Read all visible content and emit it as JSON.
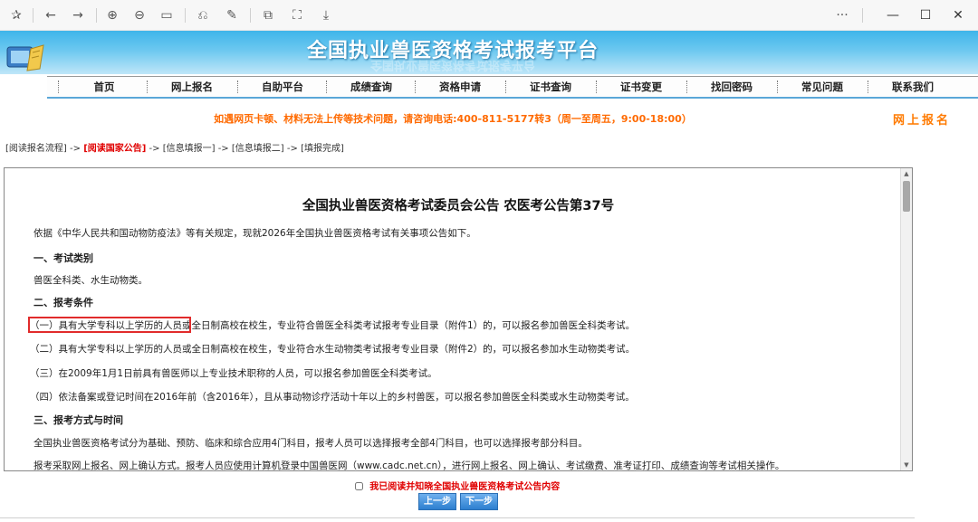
{
  "banner": {
    "title": "全国执业兽医资格考试报考平台"
  },
  "nav": [
    "首页",
    "网上报名",
    "自助平台",
    "成绩查询",
    "资格申请",
    "证书查询",
    "证书变更",
    "找回密码",
    "常见问题",
    "联系我们"
  ],
  "notice": "如遇网页卡顿、材料无法上传等技术问题，请咨询电话:400-811-5177转3（周一至周五，9:00-18:00）",
  "online_apply": "网上报名",
  "steps": {
    "s1": "[阅读报名流程]",
    "arrow": "->",
    "s2": "[阅读国家公告]",
    "s3": "[信息填报一]",
    "s4": "[信息填报二]",
    "s5": "[填报完成]"
  },
  "announcement": {
    "title": "全国执业兽医资格考试委员会公告 农医考公告第37号",
    "p1": "依据《中华人民共和国动物防疫法》等有关规定，现就2026年全国执业兽医资格考试有关事项公告如下。",
    "h1": "一、考试类别",
    "p2": "兽医全科类、水生动物类。",
    "h2": "二、报考条件",
    "c1": "（一）具有大学专科以上学历的人员或全日制高校在校生，专业符合兽医全科类考试报考专业目录（附件1）的，可以报名参加兽医全科类考试。",
    "c2": "（二）具有大学专科以上学历的人员或全日制高校在校生，专业符合水生动物类考试报考专业目录（附件2）的，可以报名参加水生动物类考试。",
    "c3": "（三）在2009年1月1日前具有兽医师以上专业技术职称的人员，可以报名参加兽医全科类考试。",
    "c4": "（四）依法备案或登记时间在2016年前（含2016年），且从事动物诊疗活动十年以上的乡村兽医，可以报名参加兽医全科类或水生动物类考试。",
    "h3": "三、报考方式与时间",
    "p3": "全国执业兽医资格考试分为基础、预防、临床和综合应用4门科目，报考人员可以选择报考全部4门科目，也可以选择报考部分科目。",
    "p4": "报考采取网上报名、网上确认方式。报考人员应使用计算机登录中国兽医网（www.cadc.net.cn），进行网上报名、网上确认、考试缴费、准考证打印、成绩查询等考试相关操作。"
  },
  "agree_text": "我已阅读并知晓全国执业兽医资格考试公告内容",
  "buttons": {
    "prev": "上一步",
    "next": "下一步"
  },
  "colors": {
    "accent_orange": "#ff6a00",
    "highlight_red": "#e12b2b",
    "banner_blue": "#3fb5ea"
  }
}
